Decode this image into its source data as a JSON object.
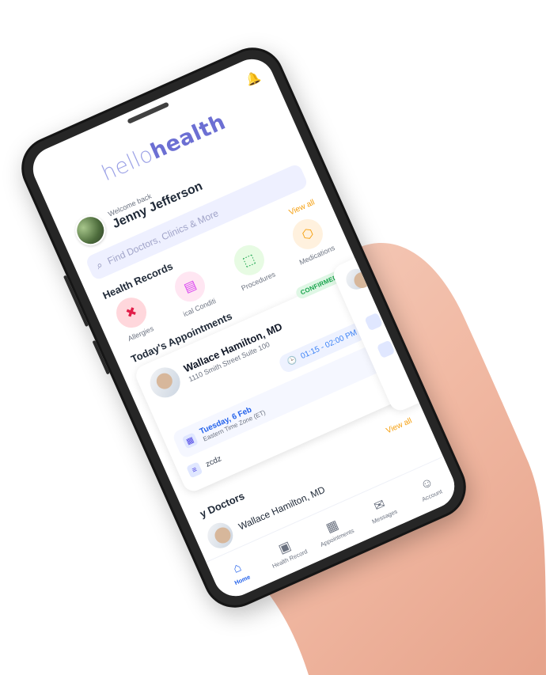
{
  "app": {
    "logo_left": "hello",
    "logo_right": "health",
    "welcome": "Welcome back",
    "user_name": "Jenny Jefferson",
    "search_placeholder": "Find Doctors, Clinics & More"
  },
  "sections": {
    "health_records_title": "Health Records",
    "health_records_view_all": "View all",
    "todays_appointments_title": "Today's Appointments",
    "doctors_title": "y Doctors",
    "doctors_view_all": "View all"
  },
  "health_records": [
    {
      "label": "Allergies",
      "icon": "allergy-icon"
    },
    {
      "label": "ical Conditi",
      "icon": "conditions-icon"
    },
    {
      "label": "Procedures",
      "icon": "procedures-icon"
    },
    {
      "label": "Medications",
      "icon": "medications-icon"
    }
  ],
  "appointment": {
    "status": "CONFIRMED",
    "doctor_name": "Wallace Hamilton, MD",
    "address": "1110 Smith Street Suite 100",
    "time": "01:15 - 02:00 PM",
    "date": "Tuesday, 6 Feb",
    "timezone": "Eastern Time Zone (ET)",
    "note": "zcdz"
  },
  "doctors": [
    {
      "name": "Wallace Hamilton, MD"
    }
  ],
  "bottom_nav": [
    {
      "label": "Home",
      "icon": "home-icon",
      "active": true
    },
    {
      "label": "Health Record",
      "icon": "health-record-icon",
      "active": false
    },
    {
      "label": "Appointments",
      "icon": "calendar-icon",
      "active": false
    },
    {
      "label": "Messages",
      "icon": "messages-icon",
      "active": false
    },
    {
      "label": "Account",
      "icon": "account-icon",
      "active": false
    }
  ],
  "colors": {
    "brand": "#6c6fd3",
    "accent": "#f59e0b",
    "primary": "#2563eb",
    "success": "#16a34a"
  }
}
